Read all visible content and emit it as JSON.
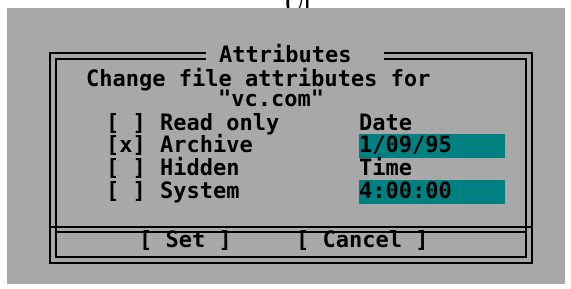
{
  "background_fragment": "(д",
  "dialog": {
    "title": "Attributes",
    "prompt": "Change file attributes for",
    "filename": "\"vc.com\""
  },
  "attributes": [
    {
      "mark": "[ ]",
      "label": "Read only",
      "checked": false
    },
    {
      "mark": "[x]",
      "label": "Archive",
      "checked": true
    },
    {
      "mark": "[ ]",
      "label": "Hidden",
      "checked": false
    },
    {
      "mark": "[ ]",
      "label": "System",
      "checked": false
    }
  ],
  "date": {
    "label": "Date",
    "value": "1/09/95"
  },
  "time": {
    "label": "Time",
    "value": "4:00:00"
  },
  "buttons": {
    "set": "[ Set ]",
    "cancel": "[ Cancel ]"
  },
  "colors": {
    "dialog_bg": "#a8a8a8",
    "field_bg": "#008080",
    "text": "#000000"
  }
}
